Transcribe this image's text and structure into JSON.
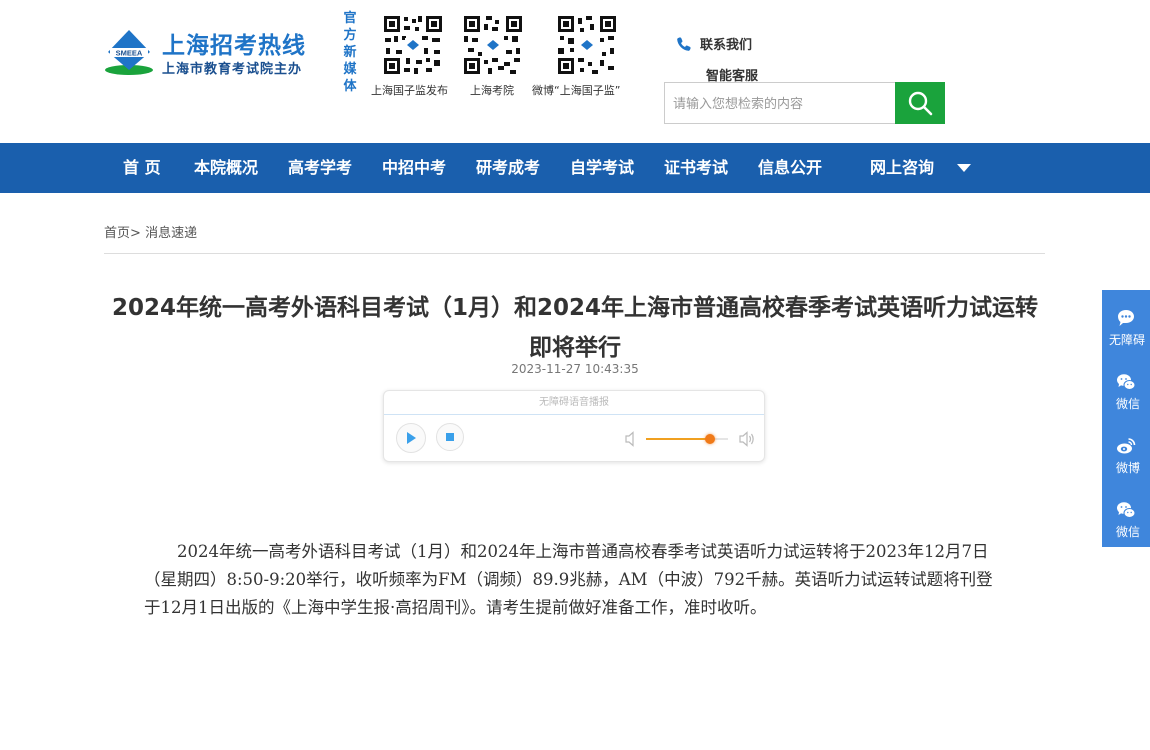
{
  "header": {
    "logo_title": "上海招考热线",
    "logo_subtitle": "上海市教育考试院主办",
    "logo_badge": "SMEEA",
    "media_label": "官方新媒体",
    "qrcodes": [
      {
        "caption": "上海国子监发布"
      },
      {
        "caption": "上海考院"
      },
      {
        "caption": "微博“上海国子监”"
      }
    ],
    "contact_label": "联系我们",
    "service_label": "智能客服",
    "search_placeholder": "请输入您想检索的内容"
  },
  "nav": {
    "items": [
      "首 页",
      "本院概况",
      "高考学考",
      "中招中考",
      "研考成考",
      "自学考试",
      "证书考试",
      "信息公开",
      "网上咨询"
    ]
  },
  "breadcrumb": {
    "home": "首页",
    "separator": ">",
    "current": "消息速递"
  },
  "article": {
    "title": "2024年统一高考外语科目考试（1月）和2024年上海市普通高校春季考试英语听力试运转即将举行",
    "date": "2023-11-27 10:43:35",
    "body": "2024年统一高考外语科目考试（1月）和2024年上海市普通高校春季考试英语听力试运转将于2023年12月7日（星期四）8:50-9:20举行，收听频率为FM（调频）89.9兆赫，AM（中波）792千赫。英语听力试运转试题将刊登于12月1日出版的《上海中学生报·高招周刊》。请考生提前做好准备工作，准时收听。"
  },
  "player": {
    "header_text": "无障碍语音播报",
    "volume": 0.78,
    "accent_color": "#f07a18"
  },
  "float_bar": {
    "items": [
      {
        "label": "无障碍",
        "icon": "accessibility-icon"
      },
      {
        "label": "微信",
        "icon": "wechat-icon"
      },
      {
        "label": "微博",
        "icon": "weibo-icon"
      },
      {
        "label": "微信",
        "icon": "wechat-icon"
      }
    ]
  },
  "colors": {
    "nav_bg": "#1a5fad",
    "search_button": "#1aa33c",
    "float_bar": "#3f86dc",
    "brand_blue": "#1f74c7"
  }
}
